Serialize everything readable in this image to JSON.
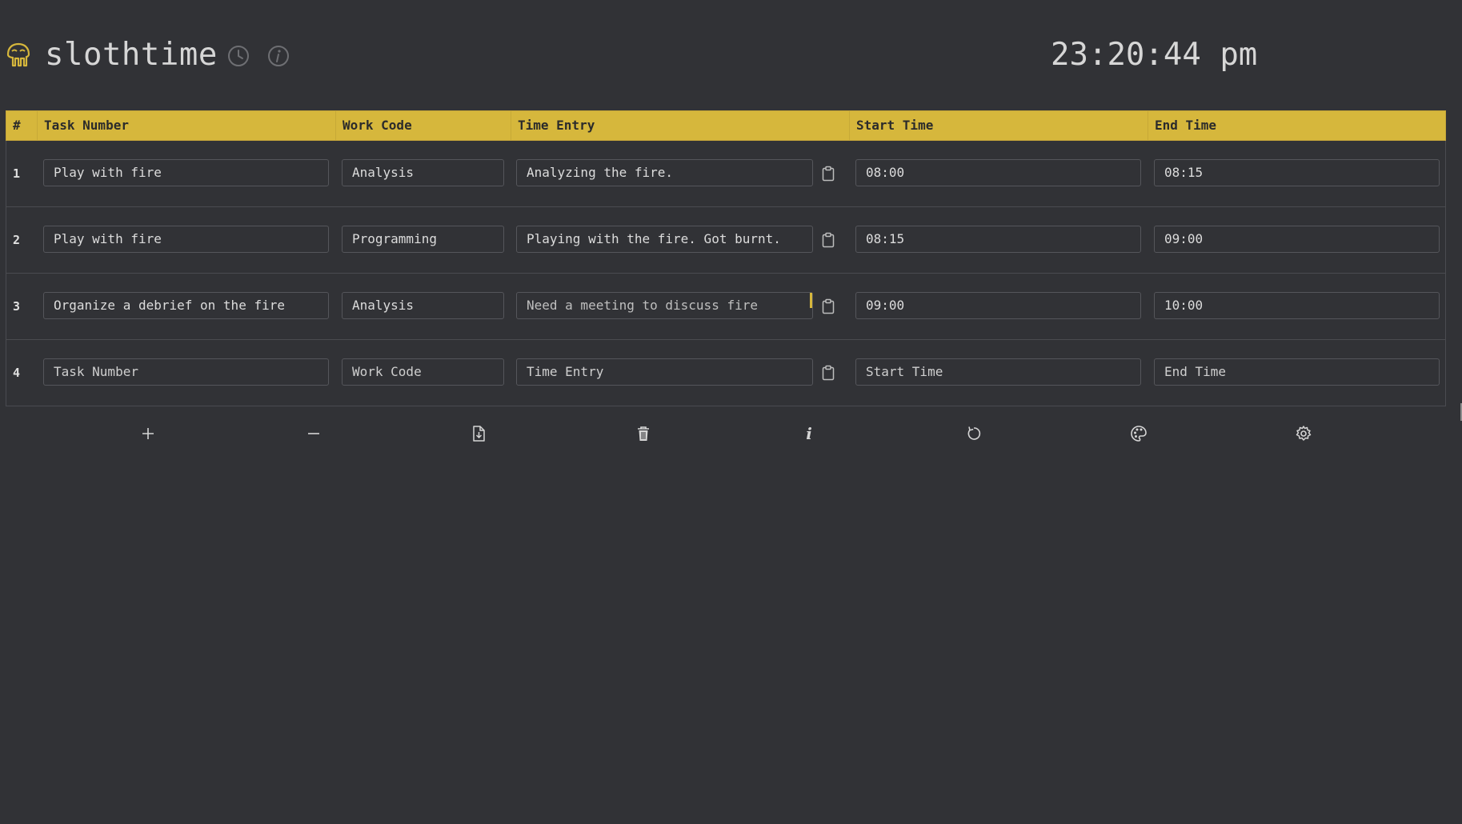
{
  "app": {
    "title": "slothtime",
    "clock": "23:20:44 pm"
  },
  "table": {
    "columns": [
      "#",
      "Task Number",
      "Work Code",
      "Time Entry",
      "Start Time",
      "End Time"
    ],
    "rows": [
      {
        "num": "1",
        "task": "Play with fire",
        "code": "Analysis",
        "entry": "Analyzing the fire.",
        "start": "08:00",
        "end": "08:15"
      },
      {
        "num": "2",
        "task": "Play with fire",
        "code": "Programming",
        "entry": "Playing with the fire. Got burnt.",
        "start": "08:15",
        "end": "09:00"
      },
      {
        "num": "3",
        "task": "Organize a debrief on the fire",
        "code": "Analysis",
        "entry": "Need a meeting to discuss fire",
        "start": "09:00",
        "end": "10:00"
      }
    ],
    "new_row": {
      "num": "4",
      "task_placeholder": "Task Number",
      "code_placeholder": "Work Code",
      "entry_placeholder": "Time Entry",
      "start_placeholder": "Start Time",
      "end_placeholder": "End Time"
    }
  },
  "toolbar": [
    "add-row-icon",
    "remove-row-icon",
    "export-icon",
    "trash-icon",
    "info-icon",
    "reset-icon",
    "palette-icon",
    "settings-icon"
  ],
  "toolbar_info_glyph": "i",
  "colors": {
    "background": "#313236",
    "accent": "#d6b73c",
    "text": "#d6d6d6"
  }
}
